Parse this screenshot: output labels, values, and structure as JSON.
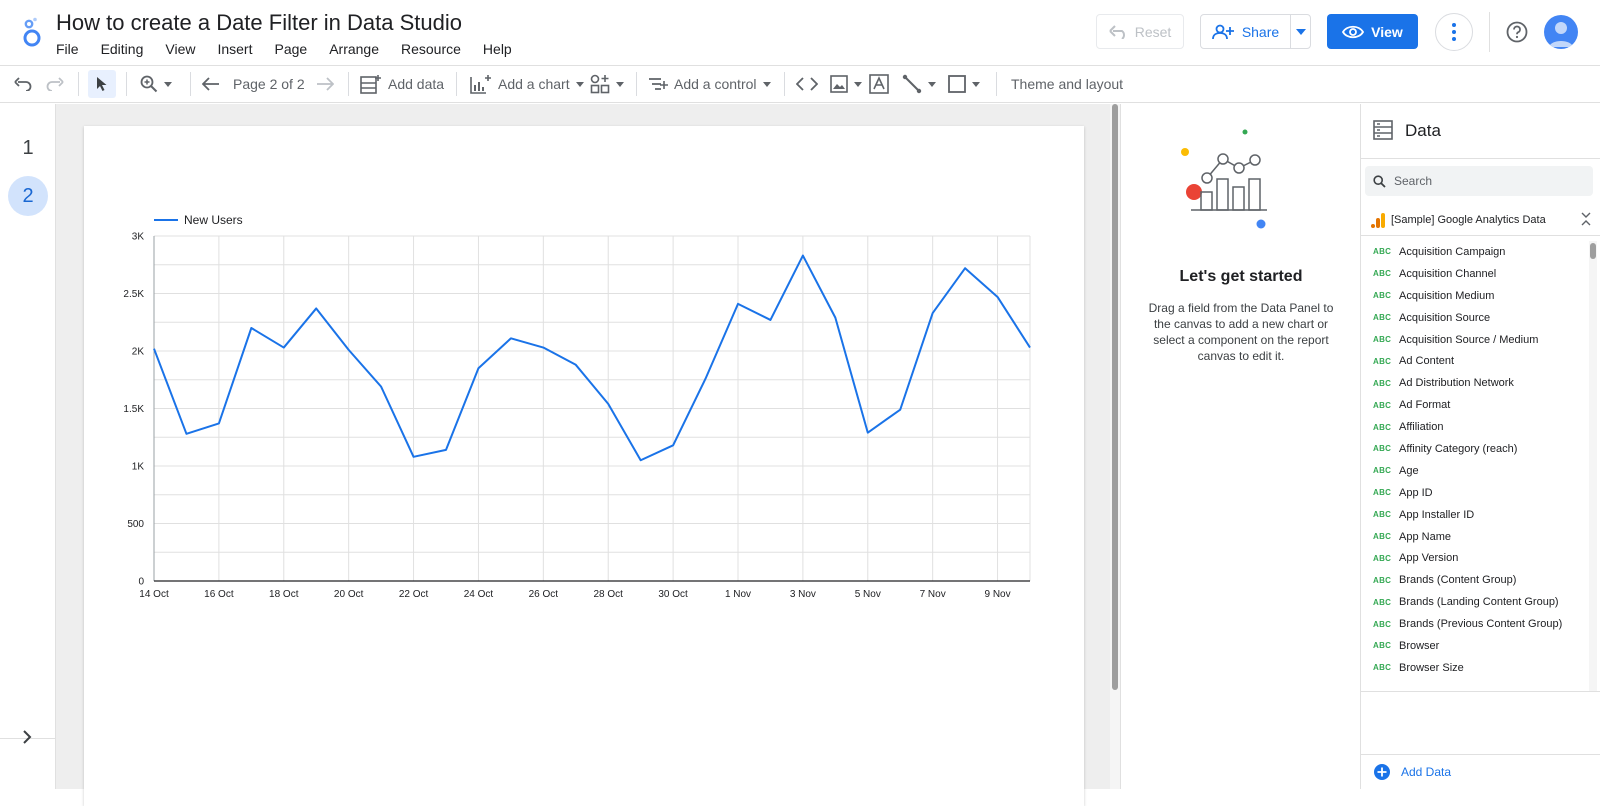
{
  "header": {
    "title": "How to create a Date Filter in Data Studio",
    "menu": [
      "File",
      "Editing",
      "View",
      "Insert",
      "Page",
      "Arrange",
      "Resource",
      "Help"
    ],
    "reset_label": "Reset",
    "share_label": "Share",
    "view_label": "View"
  },
  "toolbar": {
    "page_indicator": "Page 2 of 2",
    "add_data": "Add data",
    "add_chart": "Add a chart",
    "add_control": "Add a control",
    "theme_layout": "Theme and layout"
  },
  "pages": [
    "1",
    "2"
  ],
  "active_page": "2",
  "middle_panel": {
    "title": "Let's get started",
    "description": "Drag a field from the Data Panel to the canvas to add a new chart or select a component on the report canvas to edit it."
  },
  "data_panel": {
    "title": "Data",
    "search_placeholder": "Search",
    "source_name": "[Sample] Google Analytics Data",
    "field_type_label": "ABC",
    "fields": [
      "Acquisition Campaign",
      "Acquisition Channel",
      "Acquisition Medium",
      "Acquisition Source",
      "Acquisition Source / Medium",
      "Ad Content",
      "Ad Distribution Network",
      "Ad Format",
      "Affiliation",
      "Affinity Category (reach)",
      "Age",
      "App ID",
      "App Installer ID",
      "App Name",
      "App Version",
      "Brands (Content Group)",
      "Brands (Landing Content Group)",
      "Brands (Previous Content Group)",
      "Browser",
      "Browser Size"
    ],
    "add_data_label": "Add Data"
  },
  "colors": {
    "accent": "#1a73e8",
    "series": "#1a73e8",
    "grid": "#e0e0e0"
  },
  "chart_data": {
    "type": "line",
    "legend": "top-left",
    "grid": true,
    "series": [
      {
        "name": "New Users",
        "values": [
          2020,
          1280,
          1370,
          2200,
          2030,
          2370,
          2010,
          1690,
          1080,
          1140,
          1850,
          2110,
          2030,
          1880,
          1540,
          1050,
          1180,
          1760,
          2410,
          2270,
          2830,
          2290,
          1290,
          1490,
          2330,
          2720,
          2470,
          2030
        ]
      }
    ],
    "x": [
      "14 Oct",
      "15 Oct",
      "16 Oct",
      "17 Oct",
      "18 Oct",
      "19 Oct",
      "20 Oct",
      "21 Oct",
      "22 Oct",
      "23 Oct",
      "24 Oct",
      "25 Oct",
      "26 Oct",
      "27 Oct",
      "28 Oct",
      "29 Oct",
      "30 Oct",
      "31 Oct",
      "1 Nov",
      "2 Nov",
      "3 Nov",
      "4 Nov",
      "5 Nov",
      "6 Nov",
      "7 Nov",
      "8 Nov",
      "9 Nov",
      "10 Nov"
    ],
    "x_tick_labels": [
      "14 Oct",
      "16 Oct",
      "18 Oct",
      "20 Oct",
      "22 Oct",
      "24 Oct",
      "26 Oct",
      "28 Oct",
      "30 Oct",
      "1 Nov",
      "3 Nov",
      "5 Nov",
      "7 Nov",
      "9 Nov"
    ],
    "y_ticks": [
      0,
      500,
      1000,
      1500,
      2000,
      2500,
      3000
    ],
    "y_tick_labels": [
      "0",
      "500",
      "1K",
      "1.5K",
      "2K",
      "2.5K",
      "3K"
    ],
    "ylim": [
      0,
      3000
    ]
  }
}
